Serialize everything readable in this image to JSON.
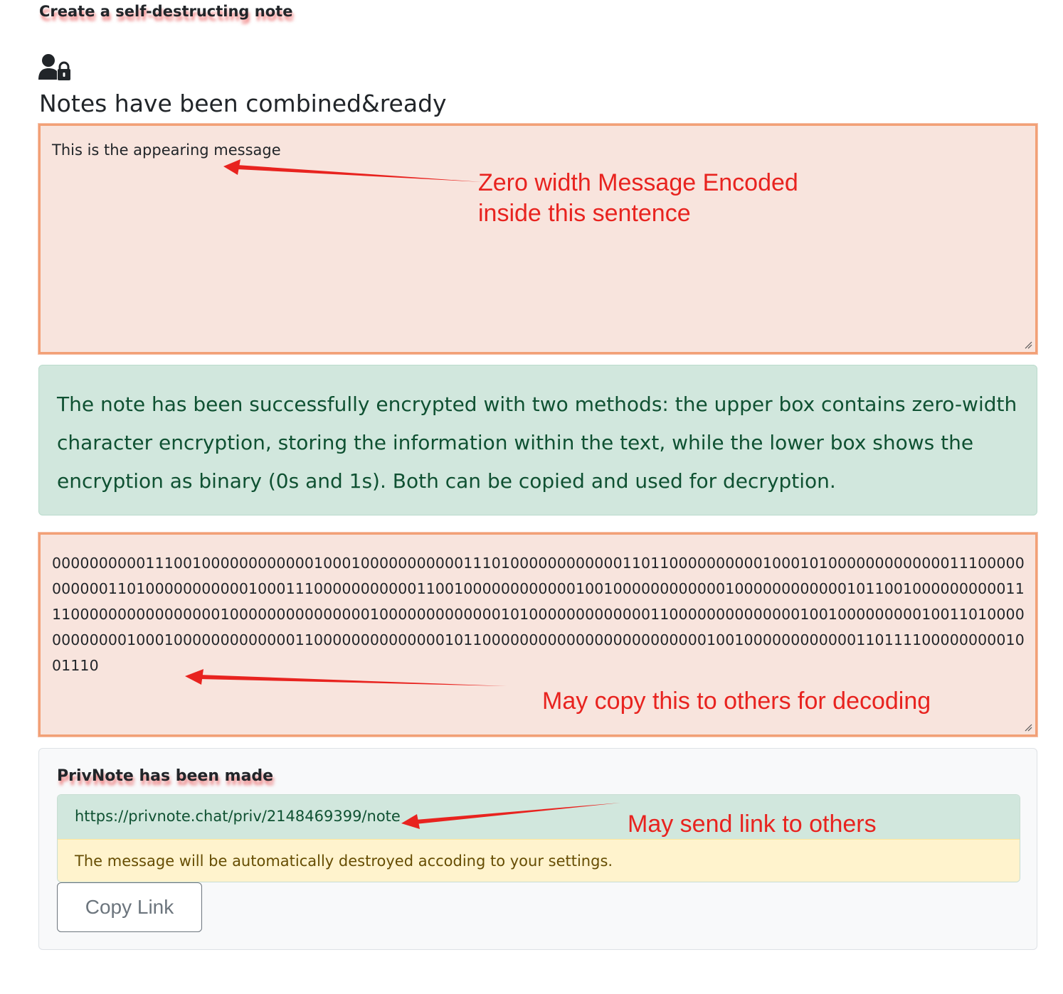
{
  "page": {
    "top_title": "Create a self-destructing note",
    "heading": "Notes have been combined&ready",
    "icon": "user-lock-icon"
  },
  "zero_width_box": {
    "text": "This is the appearing message"
  },
  "success_alert": {
    "text": "The note has been successfully encrypted with two methods: the upper box contains zero-width character encryption, storing the information within the text, while the lower box shows the encryption as binary (0s and 1s). Both can be copied and used for decryption."
  },
  "binary_box": {
    "text": "0000000000111001000000000000100010000000000011101000000000000110110000000000100010100000000000001110000000000011010000000000010001110000000000011001000000000000100100000000000010000000000001011001000000000011110000000000000000100000000000000010000000000000101000000000000011000000000000001001000000000100110100000000000010001000000000000011000000000000001011000000000000000000000000100100000000000011011110000000001001110"
  },
  "privnote": {
    "title": "PrivNote has been made",
    "link": "https://privnote.chat/priv/2148469399/note",
    "warning": "The message will be automatically destroyed accoding to your settings.",
    "copy_button_label": "Copy Link"
  },
  "annotations": {
    "zero_width_line1": "Zero width Message Encoded",
    "zero_width_line2": "inside this sentence",
    "binary_note": "May copy this to others for decoding",
    "link_note": "May send link to others",
    "color": "#e8231f"
  },
  "colors": {
    "note_bg": "#f8e4dd",
    "note_border": "#f2a076",
    "success_bg": "#d1e7dd",
    "success_text": "#0f5132",
    "warning_bg": "#fff3cd",
    "warning_text": "#664d03"
  }
}
